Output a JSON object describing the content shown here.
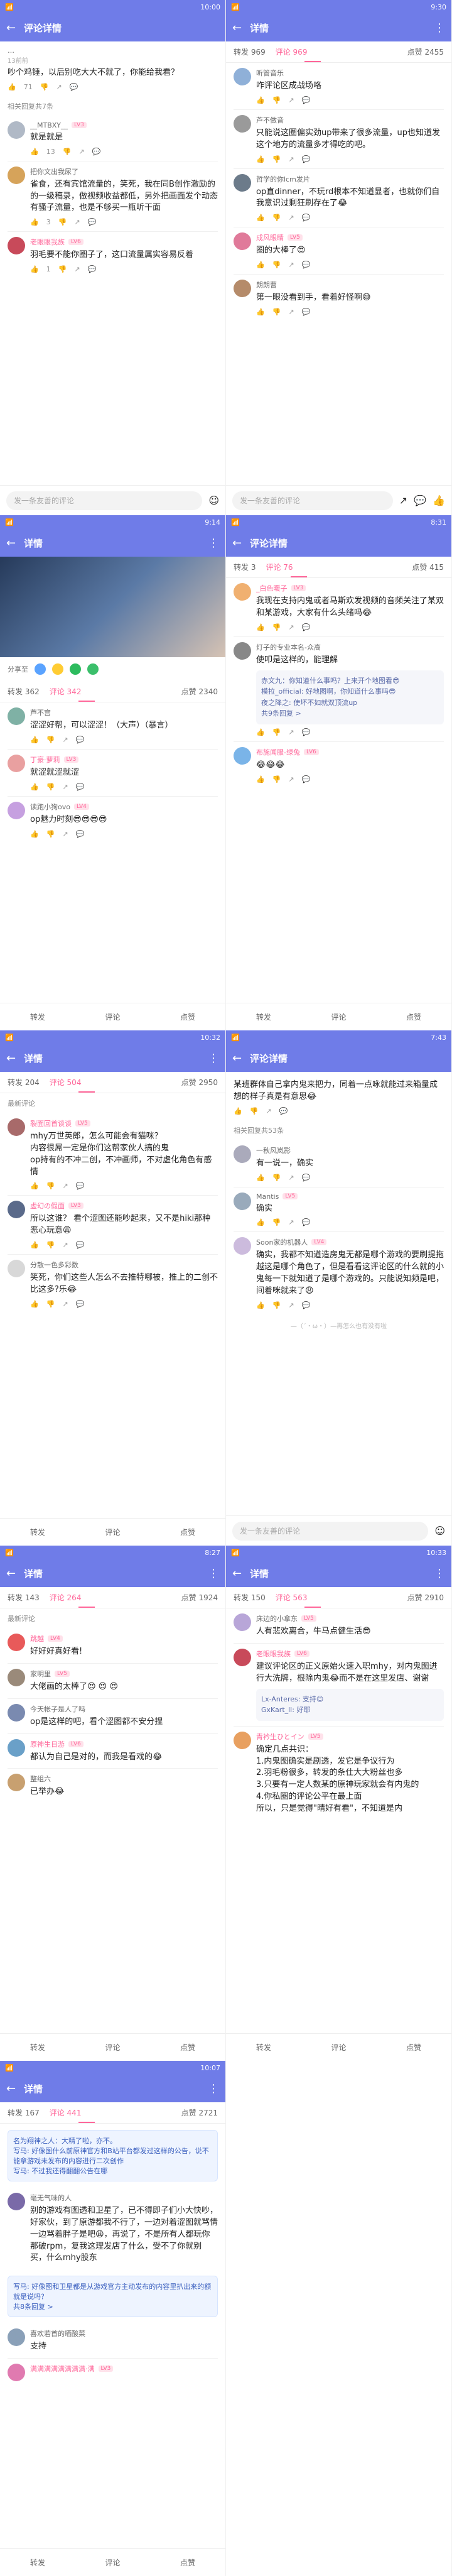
{
  "screens": [
    {
      "status_time": "10:00",
      "title": "评论详情",
      "tabs": [],
      "comments": [
        {
          "user": "…",
          "time": "13前前",
          "text": "吵个鸡锤，以后别吃大大不就了，你能给我看？",
          "likes": "71",
          "replies": ""
        },
        {
          "section": "相关回复共7条"
        },
        {
          "user": "__MTBXY__",
          "badge": "LV3",
          "time": "",
          "text": "就是就是",
          "likes": "13",
          "replies": ""
        },
        {
          "user": "把你文出我尿了",
          "badge": "",
          "time": "",
          "text": "雀食，还有宾馆流量的，笑死，我在同B创作激励的的一级稿录，做视频收益都低，另外把画面发个动态有骚子流量，也是不够买一瓶听干面",
          "likes": "3",
          "replies": ""
        },
        {
          "user": "老眼眼我族",
          "badge": "LV6",
          "time": "",
          "text": "羽毛要不能你圈子了，这口流量属实容易反着",
          "likes": "1",
          "replies": ""
        }
      ],
      "input_placeholder": "发一条友善的评论"
    },
    {
      "status_time": "9:30",
      "title": "详情",
      "tabs": [
        "转发 969",
        "评论 969",
        "点赞 2455"
      ],
      "comments": [
        {
          "user": "听管音乐",
          "time": "",
          "text": "咋评论区成战场咯",
          "likes": "",
          "replies": ""
        },
        {
          "user": "芦不做音",
          "time": "",
          "text": "只能说这圈偏实劲up带来了很多流量，up也知道发这个地方的流量多才得吃的吧。",
          "likes": "",
          "replies": ""
        },
        {
          "user": "哲学的你lcm发片",
          "time": "",
          "text": "op直dinner，不玩rd根本不知道显者，也就你们自我意识过剩狂刷存在了😂",
          "likes": "",
          "replies": ""
        },
        {
          "user": "成风眼睛",
          "badge": "LV5",
          "time": "",
          "text": "圈的大棒了😍",
          "likes": "",
          "replies": ""
        },
        {
          "user": "朗朗曹",
          "time": "",
          "text": "第一眼没看到手，看着好怪啊😅",
          "likes": "",
          "replies": ""
        }
      ],
      "input_placeholder": "发一条友善的评论"
    },
    {
      "status_time": "9:14",
      "title": "详情",
      "tabs": [
        "转发 362",
        "评论 342",
        "点赞 2340"
      ],
      "comments": [
        {
          "user": "芦不宫",
          "time": "",
          "text": "涩涩好帮，可以涩涩！（大声）（暴言）",
          "likes": "",
          "replies": ""
        },
        {
          "user": "丁豪·萝莉",
          "badge": "LV3",
          "time": "",
          "text": "就涩就涩就涩",
          "likes": "",
          "replies": ""
        },
        {
          "user": "读跑小狗ovo",
          "badge": "LV4",
          "time": "",
          "text": "op魅力时刻😎😎😎😎",
          "likes": "",
          "replies": ""
        }
      ],
      "share_label": "分享至"
    },
    {
      "status_time": "8:31",
      "title": "评论详情",
      "tabs": [
        "转发 3",
        "评论 76",
        "点赞 415"
      ],
      "comments": [
        {
          "user": "_白色暖子",
          "badge": "LV3",
          "time": "",
          "text": "我现在支持内鬼或者马斯欢发视频的音频关注了某双和某游戏，大家有什么头绪吗😂",
          "likes": "",
          "replies": ""
        },
        {
          "user": "灯子的专业本名-众高",
          "time": "",
          "text": "使叩是这样的，能理解",
          "likes": "",
          "replies": ""
        },
        {
          "quote": true,
          "lines": [
            "赤文九：你知道什么事吗？上来开个地图看😎",
            "模拉_official: 好地图啊，你知道什么事吗😎",
            "夜之降之: 使坏不如就双顶流up"
          ],
          "more": "共9条回复 >"
        },
        {
          "user": "布施闻服-绿兔",
          "badge": "LV6",
          "time": "",
          "text": "😂😂😂",
          "likes": "",
          "replies": ""
        }
      ]
    },
    {
      "status_time": "10:32",
      "title": "详情",
      "tabs": [
        "转发 204",
        "评论 504",
        "点赞 2950"
      ],
      "comments": [
        {
          "section": "最新评论"
        },
        {
          "user": "裂面回首谈谈",
          "badge": "LV5",
          "time": "",
          "text": "mhy万世英郎，怎么可能会有猫咪？\n内容很屌一定是你们这帮家伙人搞的鬼\nop持有的不冲二创，不冲画师，不对虚化角色有感情",
          "likes": "",
          "replies": ""
        },
        {
          "user": "虚幻の假面",
          "badge": "LV3",
          "time": "",
          "text": "所以这谁？ 看个涩图还能吵起来，又不是hiki那种恶心玩意😩",
          "likes": "",
          "replies": ""
        },
        {
          "user": "分散一色多彩数",
          "badge": "",
          "time": "",
          "text": "笑死，你们这些人怎么不去推特哪被，推上的二创不比这多?乐😂",
          "likes": "",
          "replies": ""
        }
      ]
    },
    {
      "status_time": "7:43",
      "title": "评论详情",
      "tabs": [],
      "comments": [
        {
          "user": "",
          "time": "",
          "text": "某班群体自己拿内鬼来把力，同着一点咏就能过来箱量成想的样子真是有意思😂",
          "likes": "",
          "replies": ""
        },
        {
          "section": "相关回复共53条"
        },
        {
          "user": "一秋风岚影",
          "badge": "",
          "time": "",
          "text": "有一说一，确实",
          "likes": "",
          "replies": ""
        },
        {
          "user": "Mantis",
          "badge": "LV5",
          "time": "",
          "text": "确实",
          "likes": "",
          "replies": ""
        },
        {
          "user": "Soon家的机器人",
          "badge": "LV4",
          "time": "",
          "text": "确实，我都不知道造房鬼无都是哪个游戏的要刷提拖越这是哪个角色了，但是看看这评论区的什么就的小鬼每一下就知道了是哪个游戏的。只能说知频是吧，间着咪就来了😩",
          "likes": "",
          "replies": ""
        }
      ],
      "end_note": "—（´・ω・）—再怎么也有没有啦",
      "input_placeholder": "发一条友善的评论"
    },
    {
      "status_time": "8:27",
      "title": "详情",
      "tabs": [
        "转发 143",
        "评论 264",
        "点赞 1924"
      ],
      "comments": [
        {
          "section": "最新评论"
        },
        {
          "user": "跳越",
          "badge": "LV4",
          "time": "",
          "text": "好好好真好看!",
          "likes": "",
          "replies": ""
        },
        {
          "user": "家明里",
          "badge": "LV5",
          "time": "",
          "text": "大佬画的太棒了😍 😍 😍",
          "likes": "",
          "replies": ""
        },
        {
          "user": "今天帐子是人了吗",
          "badge": "",
          "time": "",
          "text": "op是这样的吧，看个涩图都不安分捏",
          "likes": "",
          "replies": ""
        },
        {
          "user": "原神生日游",
          "badge": "LV6",
          "time": "",
          "text": "都认为自己是对的，而我是看戏的😂",
          "likes": "",
          "replies": ""
        },
        {
          "user": "整组六",
          "badge": "",
          "time": "",
          "text": "已举办😂",
          "likes": "",
          "replies": ""
        }
      ]
    },
    {
      "status_time": "10:33",
      "title": "详情",
      "tabs": [
        "转发 150",
        "评论 563",
        "点赞 2910"
      ],
      "comments": [
        {
          "user": "床边的小拿东",
          "badge": "LV5",
          "time": "",
          "text": "人有悲欢离合，牛马点健生活😎",
          "likes": "",
          "replies": ""
        },
        {
          "user": "老眼眼我族",
          "badge": "LV6",
          "time": "",
          "text": "建议评论区的正义原始火速入职mhy，对内鬼图进行大洗牌，根除内鬼😂而不是在这里发店、谢谢",
          "likes": "",
          "replies": ""
        },
        {
          "quote": true,
          "lines": [
            "Lx-Anteres: 支持😊",
            "GxKart_ll: 好耶"
          ],
          "more": ""
        },
        {
          "user": "青衿生ひとイン",
          "badge": "LV5",
          "time": "",
          "text": "确定几点共识：\n1.内鬼图确实是剧透，发它是争议行为\n2.羽毛粉很多，转发的条仕大大粉丝也多\n3.只要有一定人数某的原神玩家就会有内鬼的\n4.你私圈的评论公平在最上面\n所以，只是觉得\"晴好有看\"，不知道是内",
          "likes": "",
          "replies": ""
        }
      ]
    },
    {
      "status_time": "10:07",
      "title": "详情",
      "tabs": [
        "转发 167",
        "评论 441",
        "点赞 2721"
      ],
      "comments": [
        {
          "quote": true,
          "lines": [
            "名为翔神之人：大精了啦，亦不。",
            "写马: 好像图什么前原神官方和B站平台都发过这样的公告，说不能拿游戏未发布的内容进行二次创作",
            "写马: 不过我还得翻翻公告在哪"
          ],
          "more": ""
        },
        {
          "user": "毫无气味的人",
          "badge": "",
          "time": "",
          "text": "别的游戏有图透和卫星了，已不得即子们小大快吵，好家伙，到了原游都我不行了，一边对着涩图就骂情一边骂着胖子是吧😩，再说了，不是所有人都玩你那破rpm，复我这理发店了什么，受不了你就别买，什么mhy股东",
          "likes": "",
          "replies": ""
        },
        {
          "quote": true,
          "lines": [
            "写马: 好像图和卫星都是从游戏官方主动发布的内容里扒出来的额就是说吗？",
            "共8条回复 >"
          ],
          "more": ""
        },
        {
          "user": "喜欢若首的晒酸菜",
          "badge": "",
          "time": "",
          "text": "支持",
          "likes": "",
          "replies": ""
        },
        {
          "user": "满满满满满满满满·满",
          "badge": "LV3",
          "time": "",
          "text": "",
          "likes": "",
          "replies": ""
        }
      ]
    }
  ],
  "common": {
    "reply_label": "回复",
    "share_action": "转发",
    "comment_action": "评论",
    "like_action": "点赞"
  }
}
